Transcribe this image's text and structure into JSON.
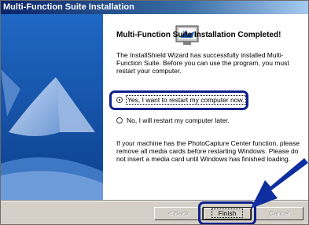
{
  "window": {
    "title": "Multi-Function Suite Installation"
  },
  "content": {
    "heading": "Multi-Function Suite Installation Completed!",
    "body": "The InstallShield Wizard has successfully installed Multi-Function Suite.  Before you can use the program, you must restart your computer.",
    "options": [
      {
        "label": "Yes, I want to restart my computer now.",
        "selected": true
      },
      {
        "label": "No, I will restart my computer later.",
        "selected": false
      }
    ],
    "note": "If your machine has the PhotoCapture Center function, please remove all media cards before restarting Windows.  Please do not insert a media card until Windows has finished loading."
  },
  "buttons": {
    "back": "< Back",
    "finish": "Finish",
    "cancel": "Cancel"
  },
  "icons": {
    "setup": "monitor-install-icon"
  },
  "colors": {
    "titlebar": "#0a246a",
    "sidebar": "#1c5fb4",
    "highlight": "#0f1f8a"
  }
}
